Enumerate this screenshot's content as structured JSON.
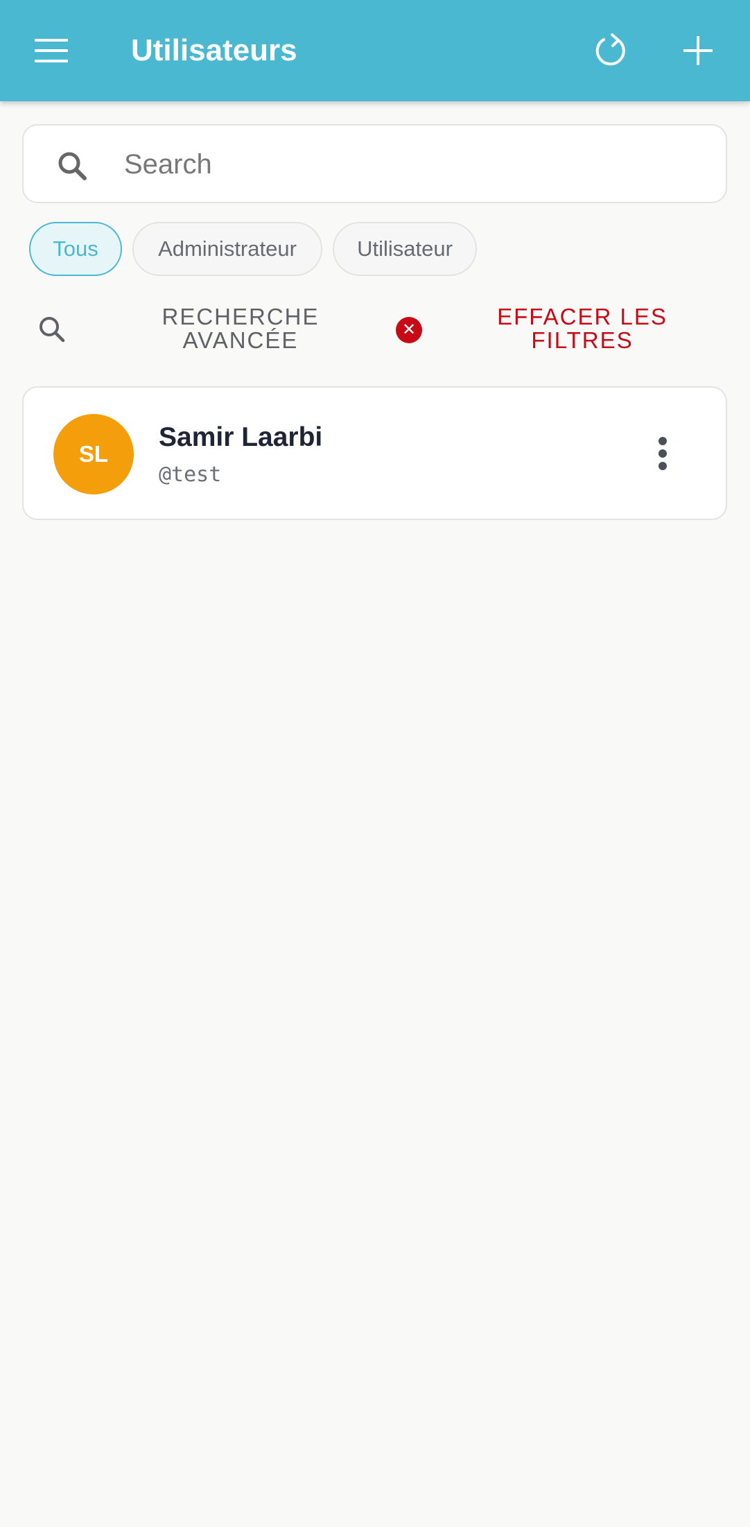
{
  "app_bar": {
    "title": "Utilisateurs",
    "menu_icon": "hamburger-menu-icon",
    "refresh_icon": "refresh-icon",
    "add_icon": "plus-icon",
    "color": "#4ab8d0"
  },
  "search": {
    "placeholder": "Search",
    "value": "",
    "icon": "search-icon"
  },
  "filters": {
    "chips": [
      {
        "label": "Tous",
        "selected": true
      },
      {
        "label": "Administrateur",
        "selected": false
      },
      {
        "label": "Utilisateur",
        "selected": false
      }
    ],
    "advanced_search_label": "RECHERCHE AVANCÉE",
    "advanced_search_icon": "search-icon",
    "clear_filters_label": "EFFACER LES FILTRES",
    "clear_filters_icon": "close-circle-icon",
    "clear_color": "#c80a16"
  },
  "users": [
    {
      "initials": "SL",
      "name": "Samir Laarbi",
      "username": "@test",
      "avatar_color": "#f59e0b",
      "more_icon": "more-vertical-icon"
    }
  ]
}
